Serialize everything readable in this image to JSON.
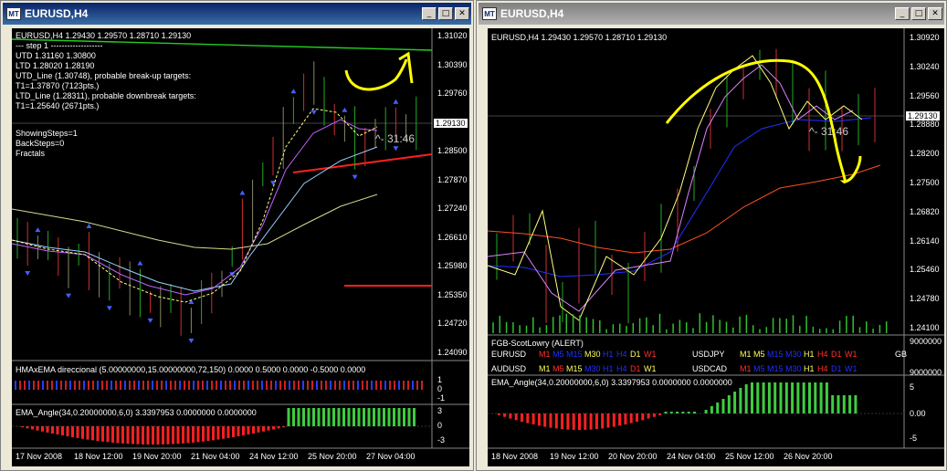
{
  "windows": [
    {
      "title": "EURUSD,H4",
      "header": "EURUSD,H4  1.29430  1.29570  1.28710  1.29130",
      "info_lines": [
        "---  step 1  -------------------",
        "UTD  1.31160  1.30800",
        "LTD  1.28020  1.28190",
        "UTD_Line (1.30748), probable break-up targets:",
        "T1=1.37870 (7123pts.)",
        "LTD_Line (1.28311), probable downbreak targets:",
        "T1=1.25640 (2671pts.)"
      ],
      "info_lines2": [
        "ShowingSteps=1",
        "BackSteps=0",
        "Fractals"
      ],
      "price_labels": [
        "1.31020",
        "1.30390",
        "1.29760",
        "1.29130",
        "1.28500",
        "1.27870",
        "1.27240",
        "1.26610",
        "1.25980",
        "1.25350",
        "1.24720",
        "1.24090"
      ],
      "current_price": "1.29130",
      "countdown": "31:46",
      "sub1_title": "HMAxEMA direccional (5.00000000,15.00000000,72,150) 0.0000 0.5000 0.0000 -0.5000 0.0000",
      "sub1_labels": [
        "1",
        "0",
        "-1"
      ],
      "sub2_title": "EMA_Angle(34,0.20000000,6,0) 3.3397953 0.0000000 0.0000000",
      "sub2_labels": [
        "3",
        "0",
        "-3"
      ],
      "dates": [
        "17 Nov 2008",
        "18 Nov 12:00",
        "19 Nov 20:00",
        "21 Nov 04:00",
        "24 Nov 12:00",
        "25 Nov 20:00",
        "27 Nov 04:00"
      ]
    },
    {
      "title": "EURUSD,H4",
      "header": "EURUSD,H4  1.29430  1.29570  1.28710  1.29130",
      "price_labels": [
        "1.30920",
        "1.30240",
        "1.29560",
        "1.28880",
        "1.28200",
        "1.27500",
        "1.26820",
        "1.26140",
        "1.25460",
        "1.24780",
        "1.24100"
      ],
      "current_price": "1.29130",
      "countdown": "31:46",
      "sub1_title": "FGB-ScotLowry (ALERT)",
      "sub1_labels": [
        "9000000",
        "9000000"
      ],
      "ticker_rows": [
        {
          "pair": "EURUSD",
          "tf": [
            [
              "M1",
              "#ff3030"
            ],
            [
              "M5",
              "#2030ff"
            ],
            [
              "M15",
              "#2030ff"
            ],
            [
              "M30",
              "#ffff60"
            ],
            [
              "H1",
              "#2030ff"
            ],
            [
              "H4",
              "#2030ff"
            ],
            [
              "D1",
              "#ffff60"
            ],
            [
              "W1",
              "#ff3030"
            ]
          ]
        },
        {
          "pair": "USDJPY",
          "tf": [
            [
              "M1",
              "#ffff60"
            ],
            [
              "M5",
              "#ffff60"
            ],
            [
              "M15",
              "#2030ff"
            ],
            [
              "M30",
              "#2030ff"
            ],
            [
              "H1",
              "#ffff60"
            ],
            [
              "H4",
              "#ff3030"
            ],
            [
              "D1",
              "#ff3030"
            ],
            [
              "W1",
              "#ff3030"
            ]
          ]
        },
        {
          "pair": "GB",
          "tf": []
        },
        {
          "pair": "AUDUSD",
          "tf": [
            [
              "M1",
              "#ffff60"
            ],
            [
              "M5",
              "#ff3030"
            ],
            [
              "M15",
              "#ffff60"
            ],
            [
              "M30",
              "#2030ff"
            ],
            [
              "H1",
              "#2030ff"
            ],
            [
              "H4",
              "#2030ff"
            ],
            [
              "D1",
              "#ff3030"
            ],
            [
              "W1",
              "#ffff60"
            ]
          ]
        },
        {
          "pair": "USDCAD",
          "tf": [
            [
              "M1",
              "#ff3030"
            ],
            [
              "M5",
              "#2030ff"
            ],
            [
              "M15",
              "#2030ff"
            ],
            [
              "M30",
              "#2030ff"
            ],
            [
              "H1",
              "#ffff60"
            ],
            [
              "H4",
              "#ff3030"
            ],
            [
              "D1",
              "#2030ff"
            ],
            [
              "W1",
              "#2030ff"
            ]
          ]
        }
      ],
      "sub2_title": "EMA_Angle(34,0.20000000,6,0) 3.3397953 0.0000000 0.0000000",
      "sub2_labels": [
        "5",
        "0.00",
        "-5"
      ],
      "dates": [
        "18 Nov 2008",
        "19 Nov 12:00",
        "20 Nov 20:00",
        "24 Nov 04:00",
        "25 Nov 12:00",
        "26 Nov 20:00"
      ]
    }
  ],
  "titlebar_buttons": [
    "minimize",
    "maximize",
    "close"
  ]
}
